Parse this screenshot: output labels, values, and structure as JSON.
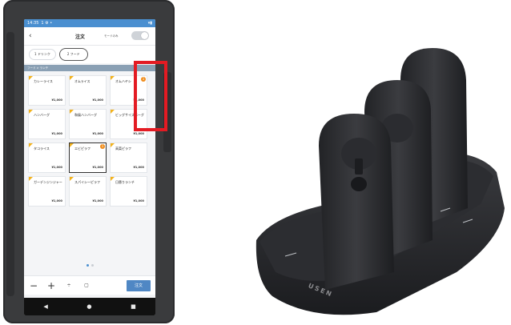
{
  "status_bar": {
    "time": "14:35",
    "icons": "1 ⚙ •",
    "right_icons": "▾▮"
  },
  "header": {
    "title": "注文",
    "mode_label": "モードのみ"
  },
  "tabs": [
    {
      "label": "1 ドリンク",
      "active": false
    },
    {
      "label": "2 フード",
      "active": true
    }
  ],
  "breadcrumb": "フード > ランチ",
  "menu_items": [
    {
      "name": "カレーライス",
      "price": "¥1,000",
      "badge": ""
    },
    {
      "name": "オムライス",
      "price": "¥1,000",
      "badge": ""
    },
    {
      "name": "オムハヤシ",
      "price": "¥1,000",
      "badge": "1"
    },
    {
      "name": "ハンバーグ",
      "price": "¥1,000",
      "badge": ""
    },
    {
      "name": "和風ハンバーグ",
      "price": "¥1,000",
      "badge": ""
    },
    {
      "name": "ビッグサイズバーグ",
      "price": "¥1,000",
      "badge": ""
    },
    {
      "name": "タコライス",
      "price": "¥1,000",
      "badge": ""
    },
    {
      "name": "エビピラフ",
      "price": "¥1,000",
      "badge": "1"
    },
    {
      "name": "高菜ピラフ",
      "price": "¥1,000",
      "badge": ""
    },
    {
      "name": "ガーデンジンジャー",
      "price": "¥1,000",
      "badge": ""
    },
    {
      "name": "スパイシーピラフ",
      "price": "¥1,000",
      "badge": ""
    },
    {
      "name": "日替りランチ",
      "price": "¥1,000",
      "badge": ""
    }
  ],
  "action_bar": {
    "minus": "−",
    "plus": "+",
    "order_button": "注文"
  },
  "nav": {
    "back": "◀",
    "home": "●",
    "recent": "■"
  },
  "photo": {
    "brand_text": "USEN"
  },
  "colors": {
    "accent": "#4f87c4",
    "highlight": "#e31b23",
    "tag": "#f3b21b",
    "badge": "#f08c1a"
  }
}
